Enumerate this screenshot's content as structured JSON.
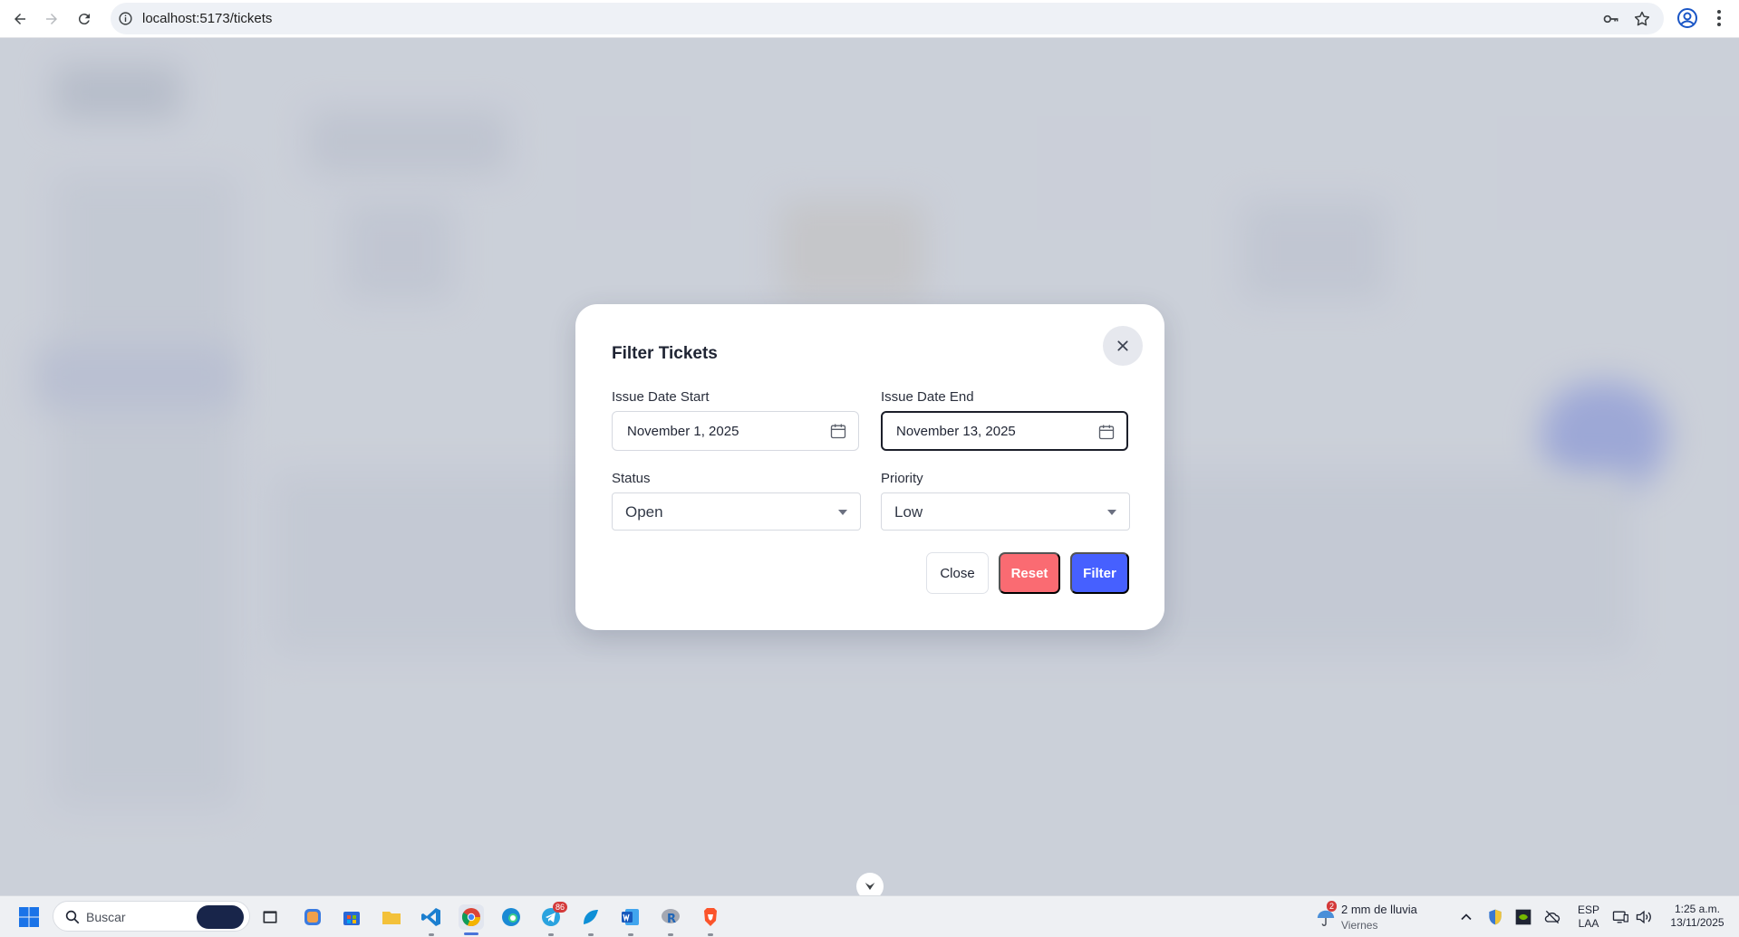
{
  "browser": {
    "url": "localhost:5173/tickets"
  },
  "modal": {
    "title": "Filter Tickets",
    "fields": {
      "issue_date_start": {
        "label": "Issue Date Start",
        "value": "November 1, 2025"
      },
      "issue_date_end": {
        "label": "Issue Date End",
        "value": "November 13, 2025"
      },
      "status": {
        "label": "Status",
        "value": "Open"
      },
      "priority": {
        "label": "Priority",
        "value": "Low"
      }
    },
    "buttons": {
      "close": "Close",
      "reset": "Reset",
      "filter": "Filter"
    }
  },
  "colors": {
    "reset": "#fa6b72",
    "filter": "#4660ff",
    "overlay": "#aab0c0"
  },
  "taskbar": {
    "search_placeholder": "Buscar",
    "telegram_badge": "86",
    "weather_badge": "2",
    "weather_text": "2 mm de lluvia",
    "weather_day": "Viernes",
    "language_line1": "ESP",
    "language_line2": "LAA",
    "time": "1:25 a.m.",
    "date": "13/11/2025",
    "apps": [
      "windows-start-icon",
      "file-explorer-icon",
      "copilot-icon",
      "microsoft-store-icon",
      "folder-icon",
      "vscode-icon",
      "chrome-icon",
      "edge-icon",
      "telegram-icon",
      "app-icon",
      "word-icon",
      "r-icon",
      "brave-icon"
    ]
  }
}
